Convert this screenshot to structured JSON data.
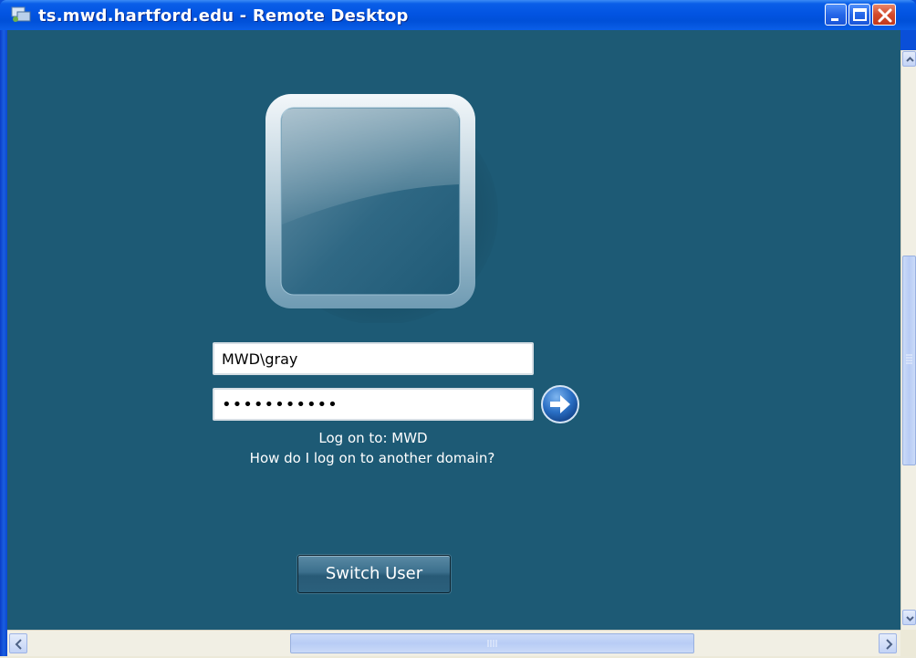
{
  "window": {
    "title": "ts.mwd.hartford.edu - Remote Desktop",
    "icon": "remote-desktop-icon"
  },
  "login": {
    "username_value": "MWD\\gray",
    "password_value": "•••••••••••",
    "logon_to": "Log on to: MWD",
    "domain_link": "How do I log on to another domain?",
    "switch_user": "Switch User"
  },
  "colors": {
    "desktop_bg": "#1d5a75",
    "titlebar": "#0254e2",
    "close_button": "#d2492b"
  }
}
